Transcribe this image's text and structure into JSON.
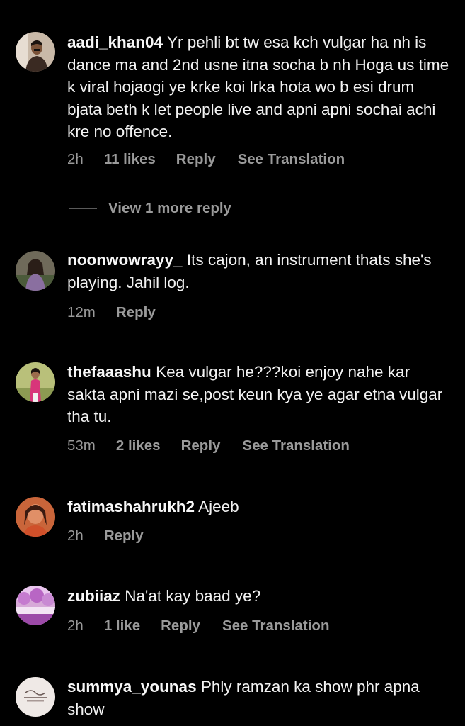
{
  "comments": [
    {
      "username": "aadi_khan04",
      "text": "Yr pehli bt tw esa kch vulgar ha nh is dance ma and 2nd usne itna socha b nh Hoga us time k viral hojaogi ye krke koi lrka hota wo b esi drum bjata beth k let people live and apni apni sochai achi kre no offence.",
      "time": "2h",
      "likes": "11 likes",
      "reply": "Reply",
      "translation": "See Translation",
      "view_more": "View 1 more reply"
    },
    {
      "username": "noonwowrayy_",
      "text": "Its cajon, an instrument thats she's playing. Jahil log.",
      "time": "12m",
      "reply": "Reply"
    },
    {
      "username": "thefaaashu",
      "text": "Kea vulgar he???koi enjoy nahe kar sakta apni mazi se,post keun kya ye agar etna vulgar tha tu.",
      "time": "53m",
      "likes": "2 likes",
      "reply": "Reply",
      "translation": "See Translation"
    },
    {
      "username": "fatimashahrukh2",
      "text": "Ajeeb",
      "time": "2h",
      "reply": "Reply"
    },
    {
      "username": "zubiiaz",
      "text": "Na'at kay baad ye?",
      "time": "2h",
      "likes": "1 like",
      "reply": "Reply",
      "translation": "See Translation"
    },
    {
      "username": "summya_younas",
      "text": "Phly ramzan ka show phr apna show"
    }
  ]
}
